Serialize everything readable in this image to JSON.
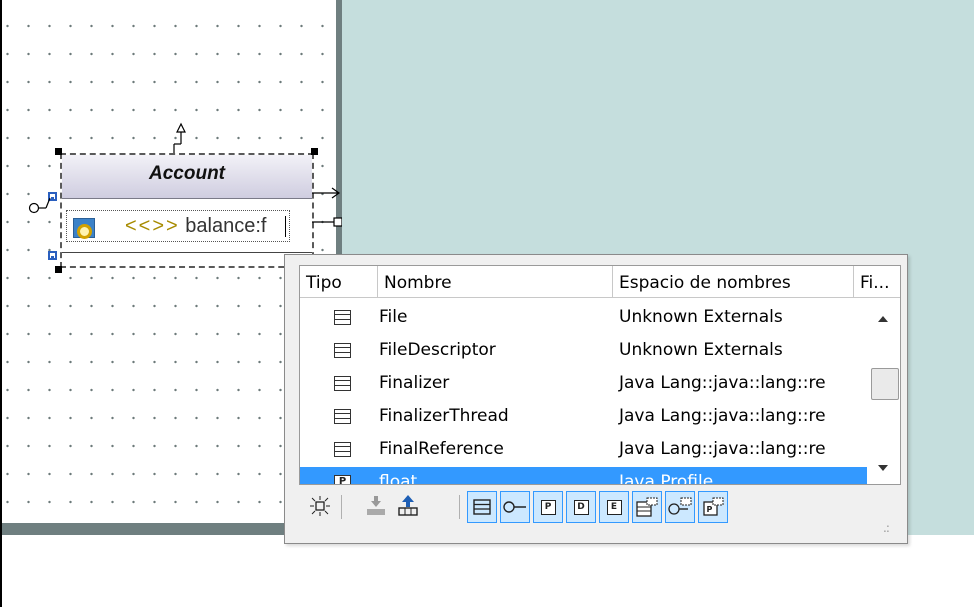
{
  "diagram": {
    "class_name": "Account",
    "attribute": {
      "stereotype": "<<>>",
      "text": "balance:f"
    }
  },
  "popup": {
    "columns": [
      "Tipo",
      "Nombre",
      "Espacio de nombres",
      "Fi..."
    ],
    "rows": [
      {
        "type_icon": "class-icon",
        "name": "File",
        "namespace": "Unknown Externals",
        "selected": false
      },
      {
        "type_icon": "class-icon",
        "name": "FileDescriptor",
        "namespace": "Unknown Externals",
        "selected": false
      },
      {
        "type_icon": "class-icon",
        "name": "Finalizer",
        "namespace": "Java Lang::java::lang::re",
        "selected": false
      },
      {
        "type_icon": "class-icon",
        "name": "FinalizerThread",
        "namespace": "Java Lang::java::lang::re",
        "selected": false
      },
      {
        "type_icon": "class-icon",
        "name": "FinalReference",
        "namespace": "Java Lang::java::lang::re",
        "selected": false
      },
      {
        "type_icon": "primitive-icon",
        "type_letter": "P",
        "name": "float",
        "namespace": "Java Profile",
        "selected": true
      }
    ],
    "toolbar": {
      "filter_letters": [
        "P",
        "D",
        "E"
      ]
    }
  },
  "colors": {
    "background": "#c5dedd",
    "selection": "#3399ff",
    "toolbar_toggle": "#cce8ff"
  }
}
